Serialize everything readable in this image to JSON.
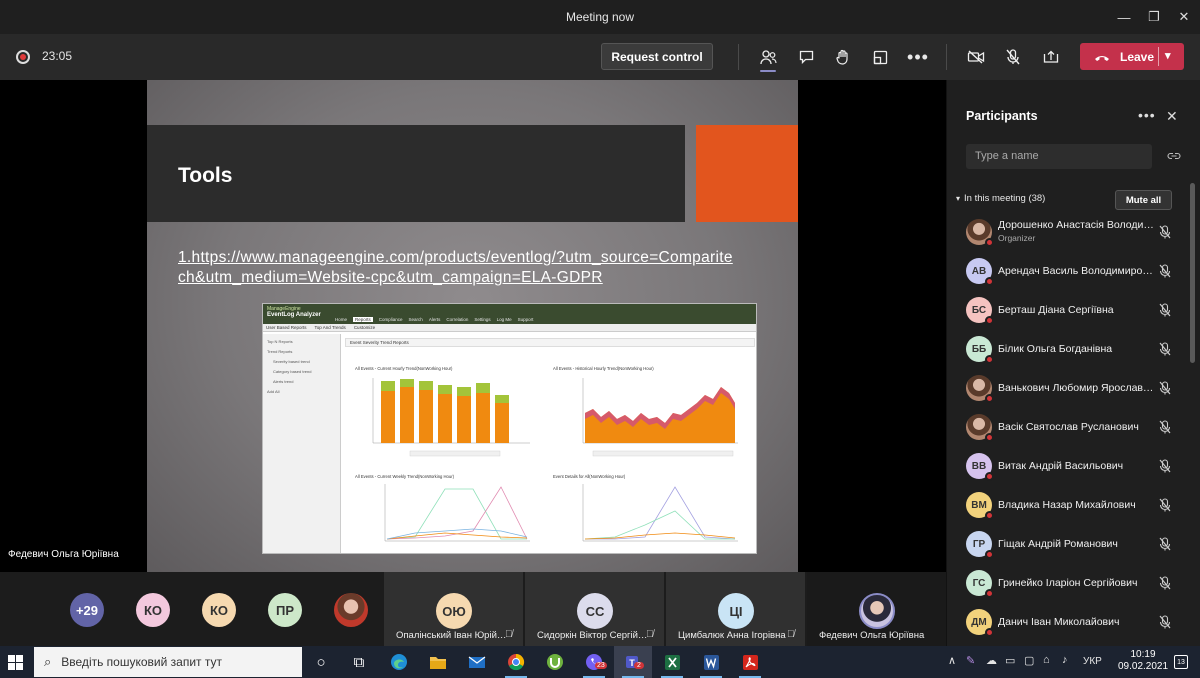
{
  "window": {
    "title": "Meeting now"
  },
  "toolbar": {
    "timer": "23:05",
    "request_control": "Request control",
    "leave_label": "Leave"
  },
  "slide": {
    "title": "Tools",
    "link_text": "1.https://www.manageengine.com/products/eventlog/?utm_source=Comparitech&utm_medium=Website-cpc&utm_campaign=ELA-GDPR",
    "embedded_screenshot": {
      "logo_top": "ManageEngine",
      "logo_name": "EventLog Analyzer",
      "tabs": [
        "Home",
        "Reports",
        "Compliance",
        "Search",
        "Alerts",
        "Correlation",
        "Settings",
        "Log Me",
        "Support"
      ],
      "subtabs": [
        "User Based Reports",
        "Top And Trends",
        "Customize"
      ],
      "sidebar": [
        "Top N Reports",
        "Trend Reports",
        "Severity based trend",
        "Category based trend",
        "Alerts trend",
        "Add All"
      ],
      "header": "Event Severity Trend Reports",
      "charts": [
        "All Events - Current Hourly Trend(NonWorking Hour)",
        "All Events - Historical Hourly Trend(NonWorking Hour)",
        "All Events - Current Weekly Trend(NonWorking Hour)",
        "Event Details for All(NonWorking Hour)"
      ]
    }
  },
  "stage": {
    "presenter_name": "Федевич Ольга Юріївна"
  },
  "participants": {
    "title": "Participants",
    "search_placeholder": "Type a name",
    "section_label": "In this meeting (38)",
    "mute_all": "Mute all",
    "list": [
      {
        "initials": "",
        "name": "Дорошенко Анастасія Володимирівна",
        "role": "Organizer",
        "color": "#e9a86a"
      },
      {
        "initials": "АВ",
        "name": "Арендач Василь Володимирович",
        "role": "",
        "color": "#c7c9f2"
      },
      {
        "initials": "БС",
        "name": "Берташ Діана Сергіївна",
        "role": "",
        "color": "#f5c3c0"
      },
      {
        "initials": "ББ",
        "name": "Білик Ольга Богданівна",
        "role": "",
        "color": "#c9e8d4"
      },
      {
        "initials": "",
        "name": "Ванькович Любомир Ярославович",
        "role": "",
        "color": "#d0a58a"
      },
      {
        "initials": "",
        "name": "Васік Святослав Русланович",
        "role": "",
        "color": "#8a8078"
      },
      {
        "initials": "ВВ",
        "name": "Витак Андрій Васильович",
        "role": "",
        "color": "#d6c3ee"
      },
      {
        "initials": "ВМ",
        "name": "Владика Назар Михайлович",
        "role": "",
        "color": "#f2d27c"
      },
      {
        "initials": "ГР",
        "name": "Гіщак Андрій Романович",
        "role": "",
        "color": "#c8d6f0"
      },
      {
        "initials": "ГС",
        "name": "Гринейко Іларіон Сергійович",
        "role": "",
        "color": "#c9e8d4"
      },
      {
        "initials": "ДМ",
        "name": "Данич Іван Миколайович",
        "role": "",
        "color": "#f2d27c"
      }
    ]
  },
  "strip": {
    "overflow": "+29",
    "avatars": [
      {
        "initials": "КО",
        "color": "#f3c8dd"
      },
      {
        "initials": "КО",
        "color": "#f6d9b0"
      },
      {
        "initials": "ПР",
        "color": "#cde8c9"
      }
    ],
    "tiles": [
      {
        "initials": "ОЮ",
        "name": "Опалінський Іван Юрійович",
        "color": "#f6d9b0"
      },
      {
        "initials": "СС",
        "name": "Сидоркін Віктор Сергійович",
        "color": "#dcdcec"
      },
      {
        "initials": "ЦІ",
        "name": "Цимбалюк Анна Ігорівна",
        "color": "#c9e4f5"
      },
      {
        "initials": "",
        "name": "Федевич Ольга Юріївна",
        "color": "#8b8cc7"
      }
    ]
  },
  "taskbar": {
    "search_placeholder": "Введіть пошуковий запит тут",
    "badges": {
      "viber": "23",
      "teams": "2"
    },
    "language": "УКР",
    "time": "10:19",
    "date": "09.02.2021",
    "notifications": "13"
  }
}
